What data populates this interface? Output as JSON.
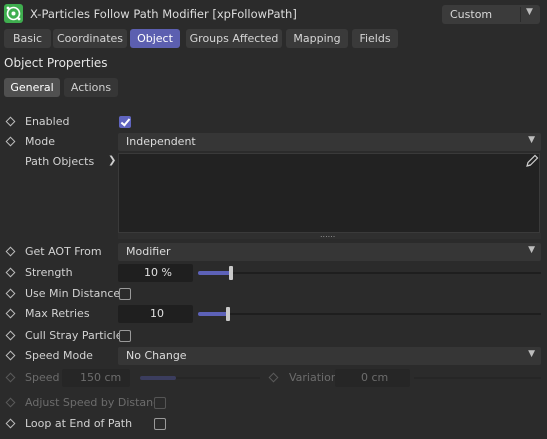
{
  "header": {
    "title": "X-Particles Follow Path Modifier [xpFollowPath]",
    "preset": "Custom"
  },
  "tabs": [
    {
      "label": "Basic"
    },
    {
      "label": "Coordinates"
    },
    {
      "label": "Object"
    },
    {
      "label": "Groups Affected"
    },
    {
      "label": "Mapping"
    },
    {
      "label": "Fields"
    }
  ],
  "section_title": "Object Properties",
  "subtabs": [
    {
      "label": "General"
    },
    {
      "label": "Actions"
    }
  ],
  "props": {
    "enabled": {
      "label": "Enabled",
      "checked": true
    },
    "mode": {
      "label": "Mode",
      "value": "Independent"
    },
    "path_objects": {
      "label": "Path Objects"
    },
    "grip": "......",
    "get_aot": {
      "label": "Get AOT From",
      "value": "Modifier"
    },
    "strength": {
      "label": "Strength",
      "value": "10 %",
      "level": 0.1
    },
    "use_min_distance": {
      "label": "Use Min Distance",
      "checked": false
    },
    "max_retries": {
      "label": "Max Retries",
      "value": "10",
      "level": 0.1
    },
    "cull_stray": {
      "label": "Cull Stray Particles",
      "checked": false
    },
    "speed_mode": {
      "label": "Speed Mode",
      "value": "No Change"
    },
    "speed": {
      "label": "Speed",
      "value": "150 cm"
    },
    "variation": {
      "label": "Variation",
      "value": "0 cm"
    },
    "adjust_speed": {
      "label": "Adjust Speed by Distance",
      "checked": false
    },
    "loop_end": {
      "label": "Loop at End of Path",
      "checked": false
    }
  },
  "colors": {
    "accent": "#5c5fb0",
    "background": "#2b2b2b",
    "icon_green": "#3fae4f"
  },
  "icons": {
    "app": "xparticles-modifier-icon",
    "edit": "pencil-icon"
  }
}
